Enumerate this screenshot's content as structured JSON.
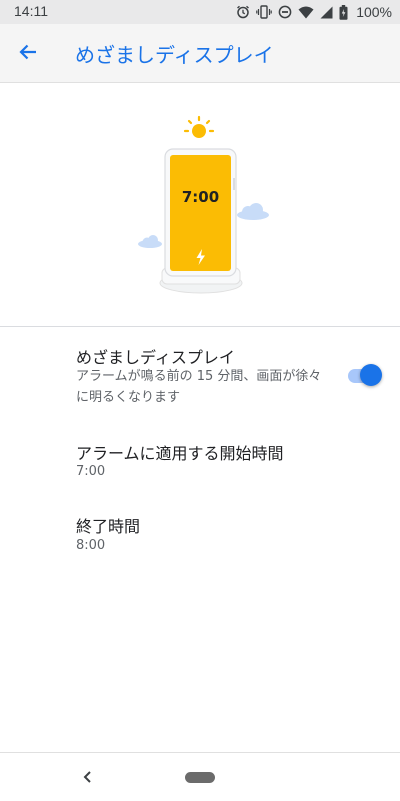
{
  "status_bar": {
    "time": "14:11",
    "battery": "100%",
    "icons": [
      "alarm-icon",
      "vibrate-icon",
      "dnd-icon",
      "wifi-icon",
      "signal-icon",
      "battery-icon"
    ]
  },
  "app_bar": {
    "title": "めざましディスプレイ",
    "back_icon": "arrow-back-icon",
    "accent_color": "#1a73e8"
  },
  "illustration": {
    "clock_time": "7:00",
    "icons": [
      "sun-icon",
      "phone-on-stand",
      "charging-bolt-icon",
      "cloud-icon"
    ],
    "phone_color": "#fbbc04"
  },
  "settings": {
    "display": {
      "title": "めざましディスプレイ",
      "summary": "アラームが鳴る前の 15 分間、画面が徐々に明るくなります",
      "toggle_on": true
    },
    "start_time": {
      "title": "アラームに適用する開始時間",
      "value": "7:00"
    },
    "end_time": {
      "title": "終了時間",
      "value": "8:00"
    }
  },
  "nav_bar": {
    "icons": [
      "nav-back-icon",
      "nav-home-pill"
    ]
  }
}
